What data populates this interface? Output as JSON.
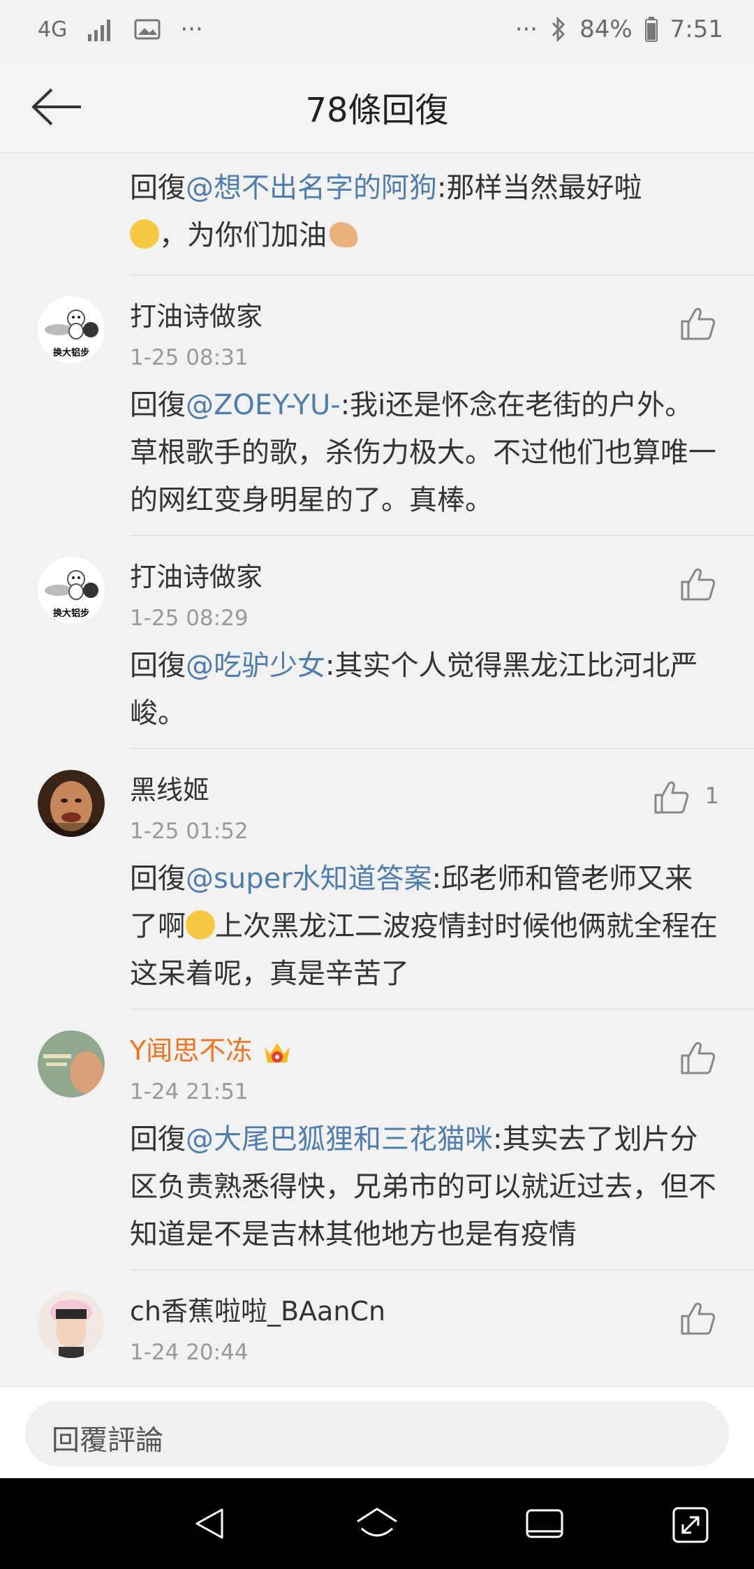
{
  "status_bar": {
    "network": "4G",
    "more": "···",
    "battery": "84%",
    "time": "7:51",
    "icons": [
      "network-4g-icon",
      "signal-icon",
      "image-icon",
      "bluetooth-icon",
      "battery-icon"
    ]
  },
  "header": {
    "title": "78條回復"
  },
  "replies": [
    {
      "partial": true,
      "prefix": "回復",
      "mention": "@想不出名字的阿狗",
      "text_a": ":那样当然最好啦",
      "text_b": "，为你们加油"
    },
    {
      "name": "打油诗做家",
      "time": "1-25 08:31",
      "prefix": "回復",
      "mention": "@ZOEY-YU-",
      "text": ":我i还是怀念在老街的户外。草根歌手的歌，杀伤力极大。不过他们也算唯一的网红变身明星的了。真棒。",
      "avatar_caption": "换大铝步"
    },
    {
      "name": "打油诗做家",
      "time": "1-25 08:29",
      "prefix": "回復",
      "mention": "@吃驴少女",
      "text": ":其实个人觉得黑龙江比河北严峻。",
      "avatar_caption": "换大铝步"
    },
    {
      "name": "黑线姬",
      "time": "1-25 01:52",
      "prefix": "回復",
      "mention": "@super水知道答案",
      "text_a": ":邱老师和管老师又来了啊",
      "text_b": "上次黑龙江二波疫情封时候他俩就全程在这呆着呢，真是辛苦了",
      "likes": "1"
    },
    {
      "name": "Y闻思不冻",
      "time": "1-24 21:51",
      "prefix": "回復",
      "mention": "@大尾巴狐狸和三花猫咪",
      "text": ":其实去了划片分区负责熟悉得快，兄弟市的可以就近过去，但不知道是不是吉林其他地方也是有疫情"
    },
    {
      "name": "ch香蕉啦啦_BAanCn",
      "time": "1-24 20:44"
    }
  ],
  "comment_input": {
    "placeholder": "回覆評論"
  },
  "colors": {
    "mention": "#4f7dae",
    "vip_name": "#f2741f",
    "background": "#f2f2f2"
  }
}
